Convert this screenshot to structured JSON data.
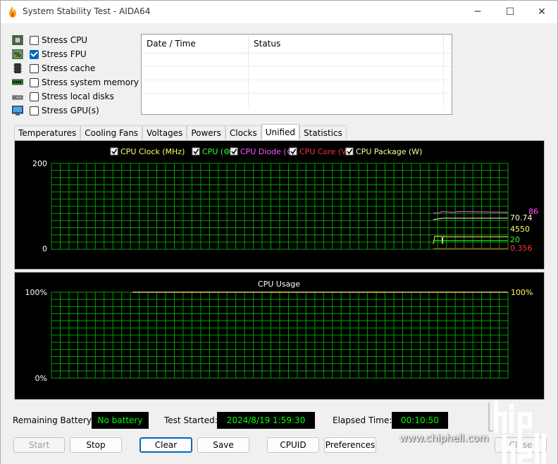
{
  "window": {
    "title": "System Stability Test - AIDA64",
    "minimize": "─",
    "maximize": "☐",
    "close": "✕"
  },
  "stress": [
    {
      "label": "Stress CPU",
      "checked": false,
      "icon": "cpu-chip-icon"
    },
    {
      "label": "Stress FPU",
      "checked": true,
      "icon": "fpu-percent-icon"
    },
    {
      "label": "Stress cache",
      "checked": false,
      "icon": "cache-memory-icon"
    },
    {
      "label": "Stress system memory",
      "checked": false,
      "icon": "ram-module-icon"
    },
    {
      "label": "Stress local disks",
      "checked": false,
      "icon": "disk-drive-icon"
    },
    {
      "label": "Stress GPU(s)",
      "checked": false,
      "icon": "monitor-icon"
    }
  ],
  "log": {
    "col_datetime": "Date / Time",
    "col_status": "Status"
  },
  "tabs": [
    "Temperatures",
    "Cooling Fans",
    "Voltages",
    "Powers",
    "Clocks",
    "Unified",
    "Statistics"
  ],
  "active_tab": "Unified",
  "unified_chart": {
    "legend": [
      {
        "label": "CPU Clock (MHz)",
        "color": "#ffff66"
      },
      {
        "label": "CPU (",
        "glyph": "⚙",
        "close": ")",
        "color": "#33ff33"
      },
      {
        "label": "CPU Diode (",
        "glyph": "⚙",
        "close": ")",
        "color": "#ff55ff"
      },
      {
        "label": "CPU Core (V)",
        "color": "#ff3333"
      },
      {
        "label": "CPU Package (W)",
        "color": "#ffff99"
      }
    ],
    "ymax_label": "200",
    "ymin_label": "0",
    "readouts": [
      {
        "text": "86",
        "color": "#ff55ff"
      },
      {
        "text": "70.74",
        "color": "#ffffcc"
      },
      {
        "text": "4550",
        "color": "#ffff66"
      },
      {
        "text": "20",
        "color": "#33ff33"
      },
      {
        "text": "0.356",
        "color": "#ff3333"
      }
    ]
  },
  "usage_chart": {
    "title": "CPU Usage",
    "ymax_label": "100%",
    "ymin_label": "0%",
    "readout": "100%"
  },
  "status": {
    "battery_label": "Remaining Battery:",
    "battery_value": "No battery",
    "started_label": "Test Started:",
    "started_value": "2024/8/19 1:59:30",
    "elapsed_label": "Elapsed Time:",
    "elapsed_value": "00:10:50"
  },
  "buttons": {
    "start": "Start",
    "stop": "Stop",
    "clear": "Clear",
    "save": "Save",
    "cpuid": "CPUID",
    "preferences": "Preferences",
    "close": "Close"
  },
  "watermark": {
    "site": "www.chiphell.com"
  },
  "chart_data": [
    {
      "type": "line",
      "ylim": [
        0,
        200
      ],
      "grid": true,
      "series": [
        {
          "name": "CPU Clock (MHz)",
          "current": 4550
        },
        {
          "name": "CPU",
          "current": 20
        },
        {
          "name": "CPU Diode",
          "current": 86
        },
        {
          "name": "CPU Core (V)",
          "current": 0.356
        },
        {
          "name": "CPU Package (W)",
          "current": 70.74
        }
      ]
    },
    {
      "type": "line",
      "title": "CPU Usage",
      "ylim": [
        0,
        100
      ],
      "grid": true,
      "series": [
        {
          "name": "CPU Usage",
          "current": 100
        }
      ]
    }
  ]
}
